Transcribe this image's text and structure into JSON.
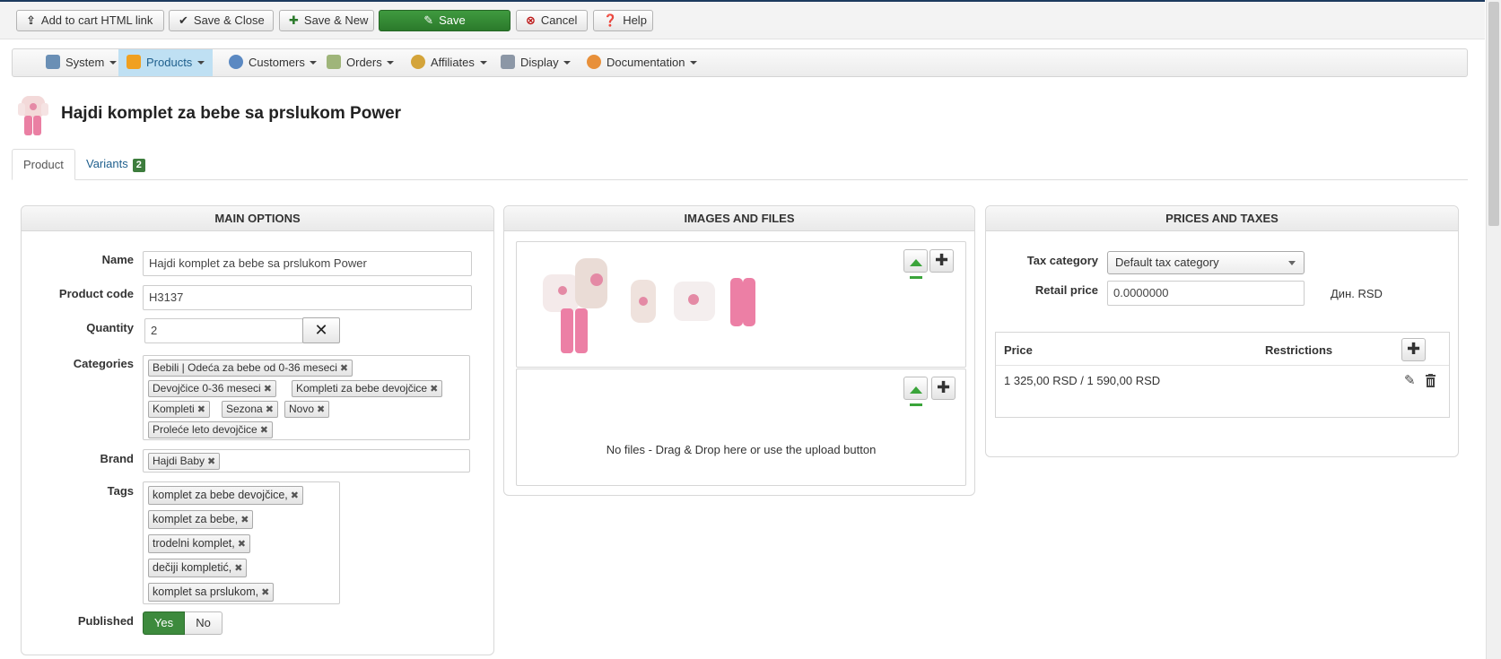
{
  "toolbar": {
    "add_to_cart": "Add to cart HTML link",
    "save_close": "Save & Close",
    "save_new": "Save & New",
    "save": "Save",
    "cancel": "Cancel",
    "help": "Help"
  },
  "menu": {
    "system": "System",
    "products": "Products",
    "customers": "Customers",
    "orders": "Orders",
    "affiliates": "Affiliates",
    "display": "Display",
    "documentation": "Documentation"
  },
  "page": {
    "title": "Hajdi komplet za bebe sa prslukom Power"
  },
  "tabs": {
    "product": "Product",
    "variants": "Variants",
    "variants_count": "2"
  },
  "main_options": {
    "heading": "MAIN OPTIONS",
    "name_label": "Name",
    "name_value": "Hajdi komplet za bebe sa prslukom Power",
    "code_label": "Product code",
    "code_value": "H3137",
    "quantity_label": "Quantity",
    "quantity_value": "2",
    "categories_label": "Categories",
    "categories": [
      "Bebili | Odeća za bebe od 0-36 meseci",
      "Devojčice 0-36 meseci",
      "Kompleti za bebe devojčice",
      "Kompleti",
      "Sezona",
      "Novo",
      "Proleće leto devojčice"
    ],
    "brand_label": "Brand",
    "brand_value": "Hajdi Baby",
    "tags_label": "Tags",
    "tags": [
      "komplet za bebe devojčice,",
      "komplet za bebe,",
      "trodelni komplet,",
      "dečiji kompletić,",
      "komplet sa prslukom,"
    ],
    "published_label": "Published",
    "yes": "Yes",
    "no": "No"
  },
  "images_files": {
    "heading": "IMAGES AND FILES",
    "no_files": "No files - Drag & Drop here or use the upload button"
  },
  "prices_taxes": {
    "heading": "PRICES AND TAXES",
    "tax_label": "Tax category",
    "tax_value": "Default tax category",
    "retail_label": "Retail price",
    "retail_value": "0.0000000",
    "currency": "Дин. RSD",
    "col_price": "Price",
    "col_restrictions": "Restrictions",
    "price_row": "1 325,00 RSD / 1 590,00 RSD"
  },
  "colors": {
    "accent_green": "#3d8a3d",
    "menu_active": "#bfe0f3",
    "link_blue": "#1f5f8d"
  }
}
